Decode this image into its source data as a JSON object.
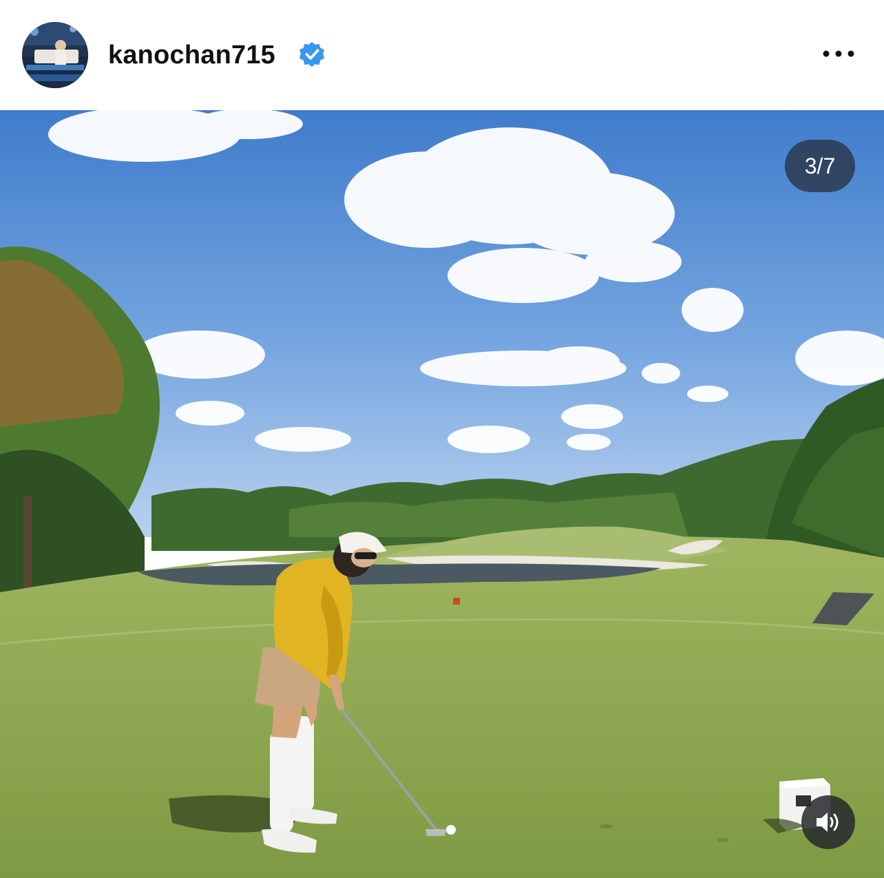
{
  "post": {
    "username": "kanochan715",
    "verified": true,
    "avatar": "profile-avatar",
    "more_icon": "more-options-icon",
    "media_counter": "3/7",
    "sound_icon": "volume-on-icon"
  },
  "colors": {
    "verified_badge": "#3897f0",
    "counter_bg": "#262d37",
    "sky": "#5b93d8",
    "grass": "#8fa94f"
  }
}
